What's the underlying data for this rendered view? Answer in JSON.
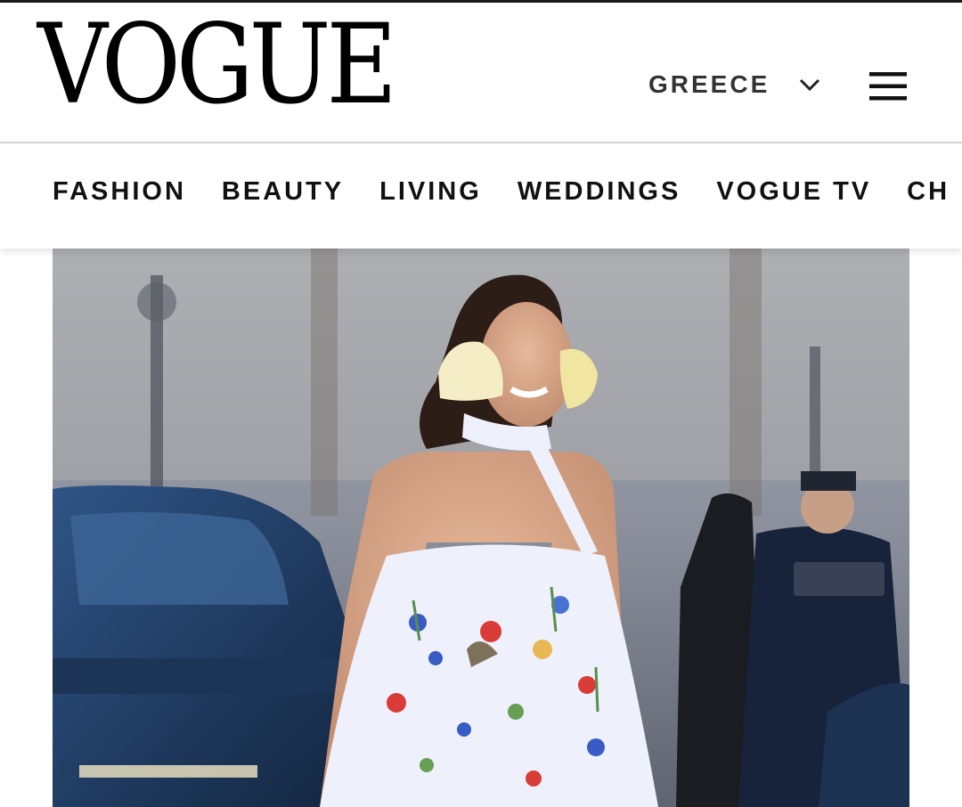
{
  "header": {
    "logo_text": "VOGUE",
    "edition": {
      "label": "GREECE",
      "icon": "chevron-down-icon"
    },
    "menu_icon": "hamburger-menu-icon"
  },
  "nav": {
    "items": [
      {
        "label": "FASHION"
      },
      {
        "label": "BEAUTY"
      },
      {
        "label": "LIVING"
      },
      {
        "label": "WEDDINGS"
      },
      {
        "label": "VOGUE TV"
      },
      {
        "label": "CH"
      }
    ]
  },
  "hero": {
    "description_icon": "street-style-photo",
    "colors": {
      "sky": "#8e96a6",
      "car": "#1f3a63",
      "dress": "#eef0fb",
      "flowers": "#f3e7a8"
    }
  }
}
